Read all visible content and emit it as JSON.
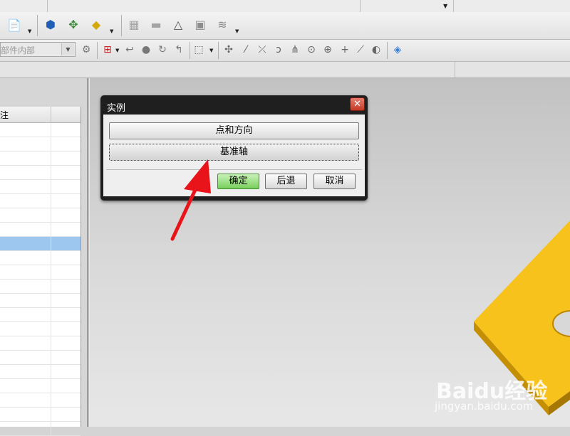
{
  "toolbar": {
    "combo_text": "部件内部"
  },
  "left_panel": {
    "column_header": "注",
    "selected_row_index": 8
  },
  "dialog": {
    "title": "实例",
    "close_glyph": "✕",
    "option_point_direction": "点和方向",
    "option_datum_axis": "基准轴",
    "ok_label": "确定",
    "back_label": "后退",
    "cancel_label": "取消"
  },
  "watermark": {
    "logo_text": "Baidu经验",
    "url_text": "jingyan.baidu.com"
  },
  "colors": {
    "plate_yellow": "#f7c21b",
    "plate_edge": "#c48f05",
    "annotation_arrow": "#e8141a",
    "selection_blue": "#9ec7f0",
    "ok_green": "#78cf5c"
  }
}
